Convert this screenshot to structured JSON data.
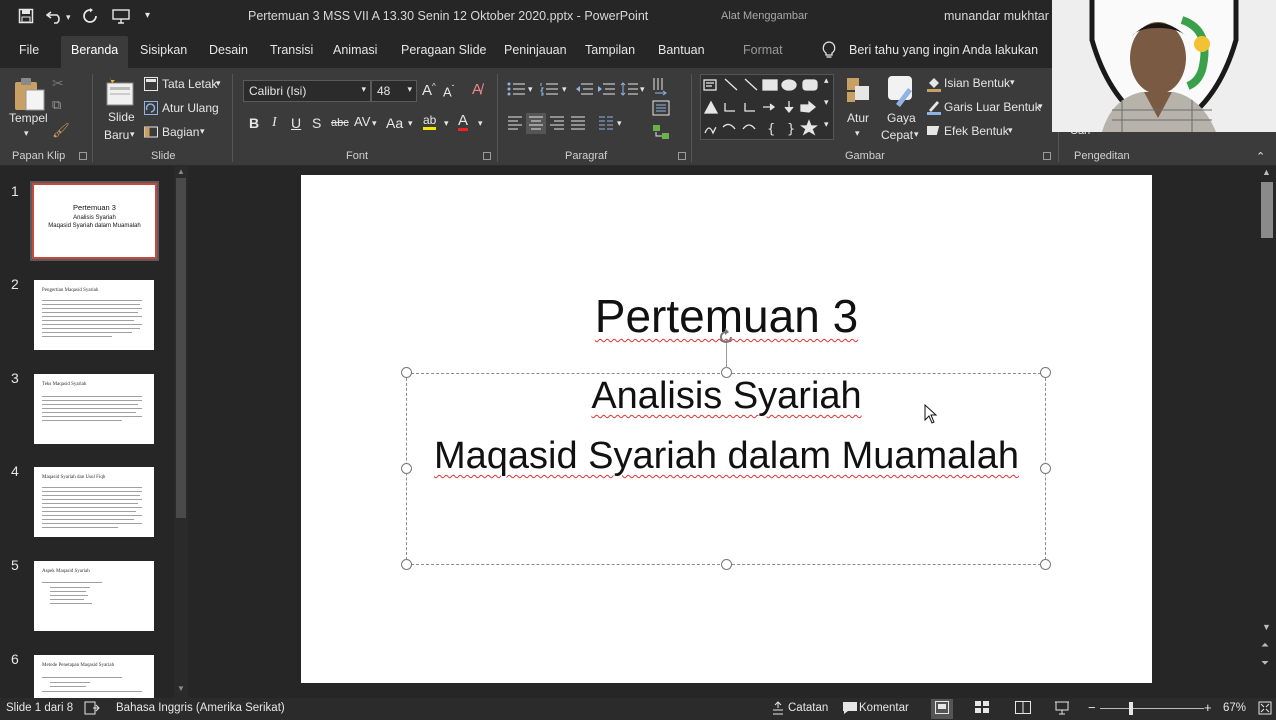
{
  "titlebar": {
    "document_title": "Pertemuan 3 MSS VII A 13.30 Senin 12 Oktober 2020.pptx  -  PowerPoint",
    "context_tab": "Alat Menggambar",
    "user": "munandar mukhtar"
  },
  "tabs": [
    "File",
    "Beranda",
    "Sisipkan",
    "Desain",
    "Transisi",
    "Animasi",
    "Peragaan Slide",
    "Peninjauan",
    "Tampilan",
    "Bantuan",
    "Format"
  ],
  "tell_me": "Beri tahu yang ingin Anda lakukan",
  "ribbon": {
    "clipboard": {
      "paste": "Tempel",
      "group": "Papan Klip"
    },
    "slides": {
      "new_slide_1": "Slide",
      "new_slide_2": "Baru",
      "layout": "Tata Letak",
      "reset": "Atur Ulang",
      "section": "Bagian",
      "group": "Slide"
    },
    "font": {
      "family": "Calibri (Isi)",
      "size": "48",
      "bold": "B",
      "italic": "I",
      "underline": "U",
      "shadow": "S",
      "strike": "abc",
      "spacing": "AV",
      "case": "Aa",
      "grow": "A",
      "shrink": "A",
      "highlight": "ab",
      "color": "A",
      "group": "Font"
    },
    "paragraph": {
      "group": "Paragraf"
    },
    "drawing": {
      "arrange": "Atur",
      "quick_styles_1": "Gaya",
      "quick_styles_2": "Cepat",
      "fill": "Isian Bentuk",
      "outline": "Garis Luar Bentuk",
      "effects": "Efek Bentuk",
      "group": "Gambar"
    },
    "editing": {
      "find": "Cari",
      "group": "Pengeditan"
    }
  },
  "thumbnails": [
    {
      "num": "1",
      "title": "Pertemuan 3",
      "lines": [
        "Analisis Syariah",
        "Maqasid Syariah dalam Muamalah"
      ]
    },
    {
      "num": "2",
      "heading": "Pengertian Maqasid Syariah"
    },
    {
      "num": "3",
      "heading": "Teks Maqasid Syariah"
    },
    {
      "num": "4",
      "heading": "Maqasid Syariah dan Usul Fiqh"
    },
    {
      "num": "5",
      "heading": "Aspek Maqasid Syariah"
    },
    {
      "num": "6",
      "heading": "Metode Penetapan Maqasid Syariah"
    }
  ],
  "slide": {
    "title": "Pertemuan 3",
    "subtitle_1": "Analisis Syariah",
    "subtitle_2": "Maqasid Syariah dalam Muamalah"
  },
  "status": {
    "slide_info": "Slide 1 dari 8",
    "language": "Bahasa Inggris (Amerika Serikat)",
    "notes": "Catatan",
    "comments": "Komentar",
    "zoom": "67%"
  }
}
